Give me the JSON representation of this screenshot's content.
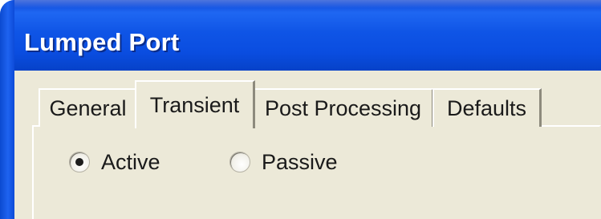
{
  "window": {
    "title": "Lumped Port"
  },
  "tabs": [
    {
      "label": "General",
      "selected": false
    },
    {
      "label": "Transient",
      "selected": true
    },
    {
      "label": "Post Processing",
      "selected": false
    },
    {
      "label": "Defaults",
      "selected": false
    }
  ],
  "options": {
    "active": {
      "label": "Active",
      "selected": true
    },
    "passive": {
      "label": "Passive",
      "selected": false
    }
  },
  "colors": {
    "titlebar": "#0f55e6",
    "client": "#ece9d8",
    "title_text": "#ffffff"
  }
}
